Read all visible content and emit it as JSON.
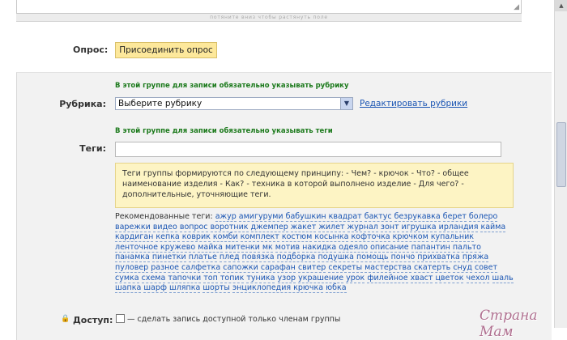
{
  "editor": {
    "drag_hint": "потяните вниз чтобы растянуть поле"
  },
  "poll": {
    "label": "Опрос:",
    "button_label": "Присоединить опрос"
  },
  "rubric": {
    "notice": "В этой группе для записи обязательно указывать рубрику",
    "label": "Рубрика:",
    "selected": "Выберите рубрику",
    "edit_link": "Редактировать рубрики"
  },
  "tags": {
    "notice": "В этой группе для записи обязательно указывать теги",
    "label": "Теги:",
    "input_value": "",
    "hint": "Теги группы формируются по следующему принципу: - Чем? - крючок - Что? - общее наименование изделия - Как? - техника в которой выполнено изделие - Для чего? - дополнительные, уточняющие теги.",
    "recommended_label": "Рекомендованные теги:",
    "recommended": [
      "ажур",
      "амигуруми",
      "бабушкин квадрат",
      "бактус",
      "безрукавка",
      "берет",
      "болеро",
      "варежки",
      "видео",
      "вопрос",
      "воротник",
      "джемпер",
      "жакет",
      "жилет",
      "журнал",
      "зонт",
      "игрушка",
      "ирландия",
      "кайма",
      "кардиган",
      "кепка",
      "коврик",
      "комби",
      "комплект",
      "костюм",
      "косынка",
      "кофточка",
      "крючком",
      "купальник",
      "ленточное кружево",
      "майка",
      "митенки",
      "мк",
      "мотив",
      "накидка",
      "одеяло",
      "описание",
      "папантин",
      "пальто",
      "панамка",
      "пинетки",
      "платье",
      "плед",
      "повязка",
      "подборка",
      "подушка",
      "помощь",
      "пончо",
      "прихватка",
      "пряжа",
      "пуловер",
      "разное",
      "салфетка",
      "сапожки",
      "сарафан",
      "свитер",
      "секреты мастерства",
      "скатерть",
      "снуд",
      "совет",
      "сумка",
      "схема",
      "тапочки",
      "топ",
      "топик",
      "туника",
      "узор",
      "украшение",
      "урок",
      "филейное",
      "хваст",
      "цветок",
      "чехол",
      "шаль",
      "шапка",
      "шарф",
      "шляпка",
      "шорты",
      "энциклопедия крючка",
      "юбка"
    ]
  },
  "access": {
    "label": "Доступ:",
    "checkbox_text": "— сделать запись доступной только членам группы"
  },
  "watermark": "Страна Мам",
  "icons": {
    "select_arrow": "chevron-down-icon",
    "access": "lock-icon"
  }
}
